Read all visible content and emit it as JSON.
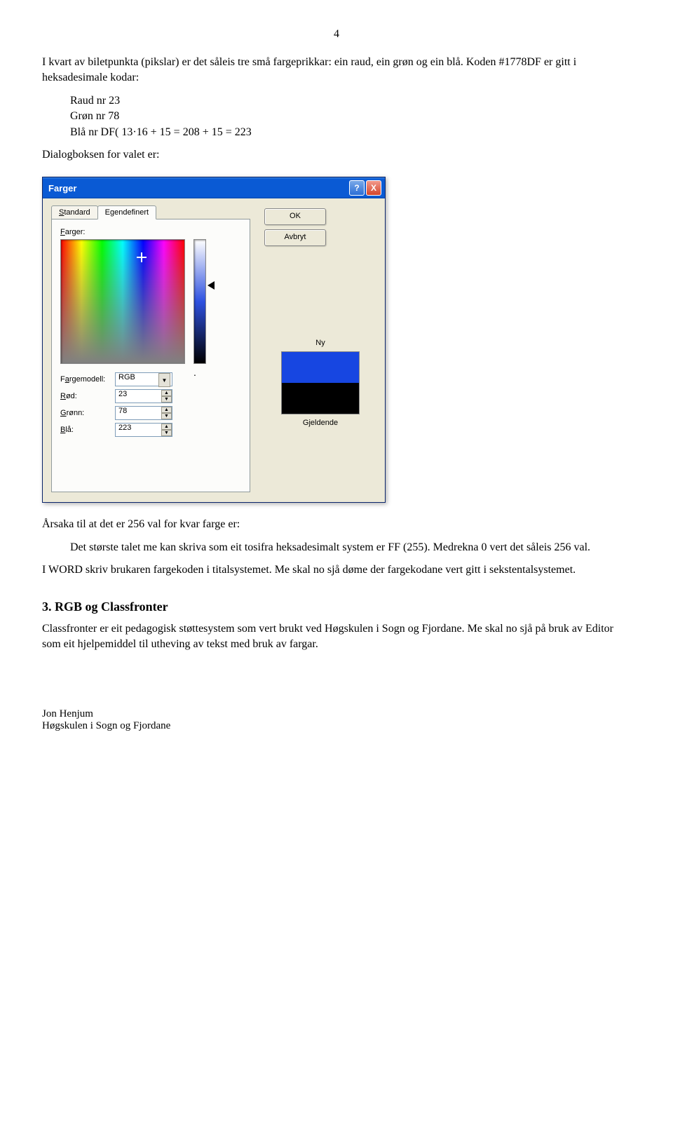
{
  "page_number": "4",
  "para1": "I kvart av biletpunkta (pikslar) er det såleis tre små fargeprikkar: ein raud, ein grøn og ein blå. Koden #1778DF er gitt i heksadesimale kodar:",
  "codes": {
    "line1": "Raud nr 23",
    "line2": "Grøn nr 78",
    "line3": "Blå nr DF( 13·16 + 15 = 208 + 15 = 223"
  },
  "para2": "Dialogboksen for valet er:",
  "dialog": {
    "title": "Farger",
    "help": "?",
    "close": "X",
    "tab_standard": "Standard",
    "tab_custom": "Egendefinert",
    "ok": "OK",
    "cancel": "Avbryt",
    "label_farger": "Farger:",
    "label_model": "Fargemodell:",
    "model_value": "RGB",
    "label_red": "Rød:",
    "red_value": "23",
    "label_green": "Grønn:",
    "green_value": "78",
    "label_blue": "Blå:",
    "blue_value": "223",
    "new_label": "Ny",
    "current_label": "Gjeldende"
  },
  "para3": "Årsaka til at det er 256 val for kvar farge er:",
  "para4": "Det største talet me kan skriva som eit tosifra heksadesimalt system er FF (255). Medrekna 0 vert det såleis 256 val.",
  "para5": "I WORD skriv brukaren fargekoden i titalsystemet. Me skal no sjå døme der fargekodane vert gitt i sekstentalsystemet.",
  "heading": "3. RGB og Classfronter",
  "para6": "Classfronter er eit pedagogisk støttesystem som vert brukt ved  Høgskulen i Sogn og Fjordane. Me skal no sjå på bruk av Editor som eit hjelpemiddel til utheving av tekst med bruk av fargar.",
  "footer_line1": "Jon Henjum",
  "footer_line2": "Høgskulen i Sogn og Fjordane"
}
